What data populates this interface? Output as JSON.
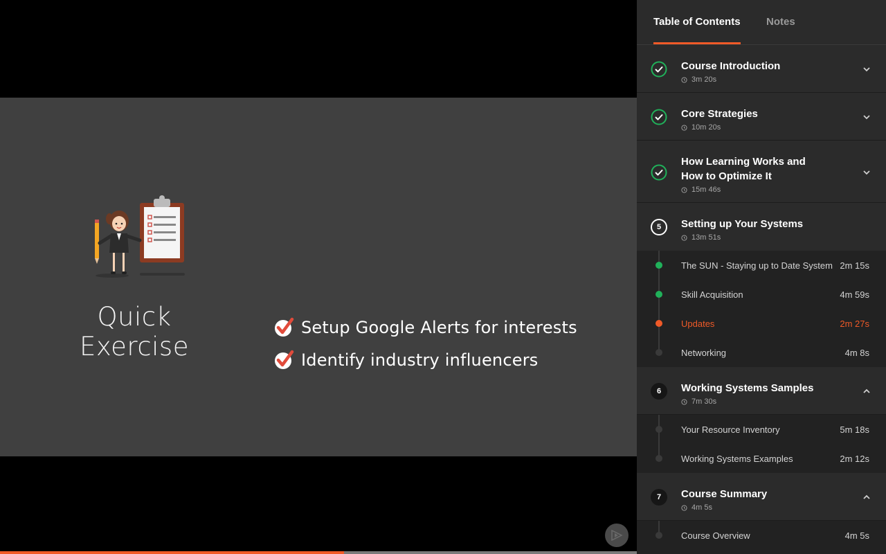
{
  "player": {
    "slide": {
      "title_line1": "Quick",
      "title_line2": "Exercise",
      "bullets": [
        "Setup Google Alerts for interests",
        "Identify industry influencers"
      ]
    },
    "progress": 0.54,
    "colors": {
      "accent": "#f05a28",
      "complete": "#20b15a",
      "slide_bg": "#404040"
    }
  },
  "sidebar": {
    "tabs": [
      {
        "label": "Table of Contents",
        "active": true
      },
      {
        "label": "Notes",
        "active": false
      }
    ],
    "modules": [
      {
        "title": "Course Introduction",
        "duration": "3m 20s",
        "status": "complete",
        "expanded": false
      },
      {
        "title": "Core Strategies",
        "duration": "10m 20s",
        "status": "complete",
        "expanded": false
      },
      {
        "title_line1": "How Learning Works and",
        "title_line2": "How to Optimize It",
        "duration": "15m 46s",
        "status": "complete",
        "expanded": false
      },
      {
        "number": "5",
        "title": "Setting up Your Systems",
        "duration": "13m 51s",
        "status": "in-progress",
        "expanded": true,
        "clips": [
          {
            "title": "The SUN - Staying up to Date System",
            "duration": "2m 15s",
            "status": "complete"
          },
          {
            "title": "Skill Acquisition",
            "duration": "4m 59s",
            "status": "complete"
          },
          {
            "title": "Updates",
            "duration": "2m 27s",
            "status": "current"
          },
          {
            "title": "Networking",
            "duration": "4m 8s",
            "status": "not-started"
          }
        ]
      },
      {
        "number": "6",
        "title": "Working Systems Samples",
        "duration": "7m 30s",
        "status": "not-started",
        "expanded": true,
        "clips": [
          {
            "title": "Your Resource Inventory",
            "duration": "5m 18s",
            "status": "not-started"
          },
          {
            "title": "Working Systems Examples",
            "duration": "2m 12s",
            "status": "not-started"
          }
        ]
      },
      {
        "number": "7",
        "title": "Course Summary",
        "duration": "4m 5s",
        "status": "not-started",
        "expanded": true,
        "clips": [
          {
            "title": "Course Overview",
            "duration": "4m 5s",
            "status": "not-started"
          }
        ]
      }
    ]
  }
}
